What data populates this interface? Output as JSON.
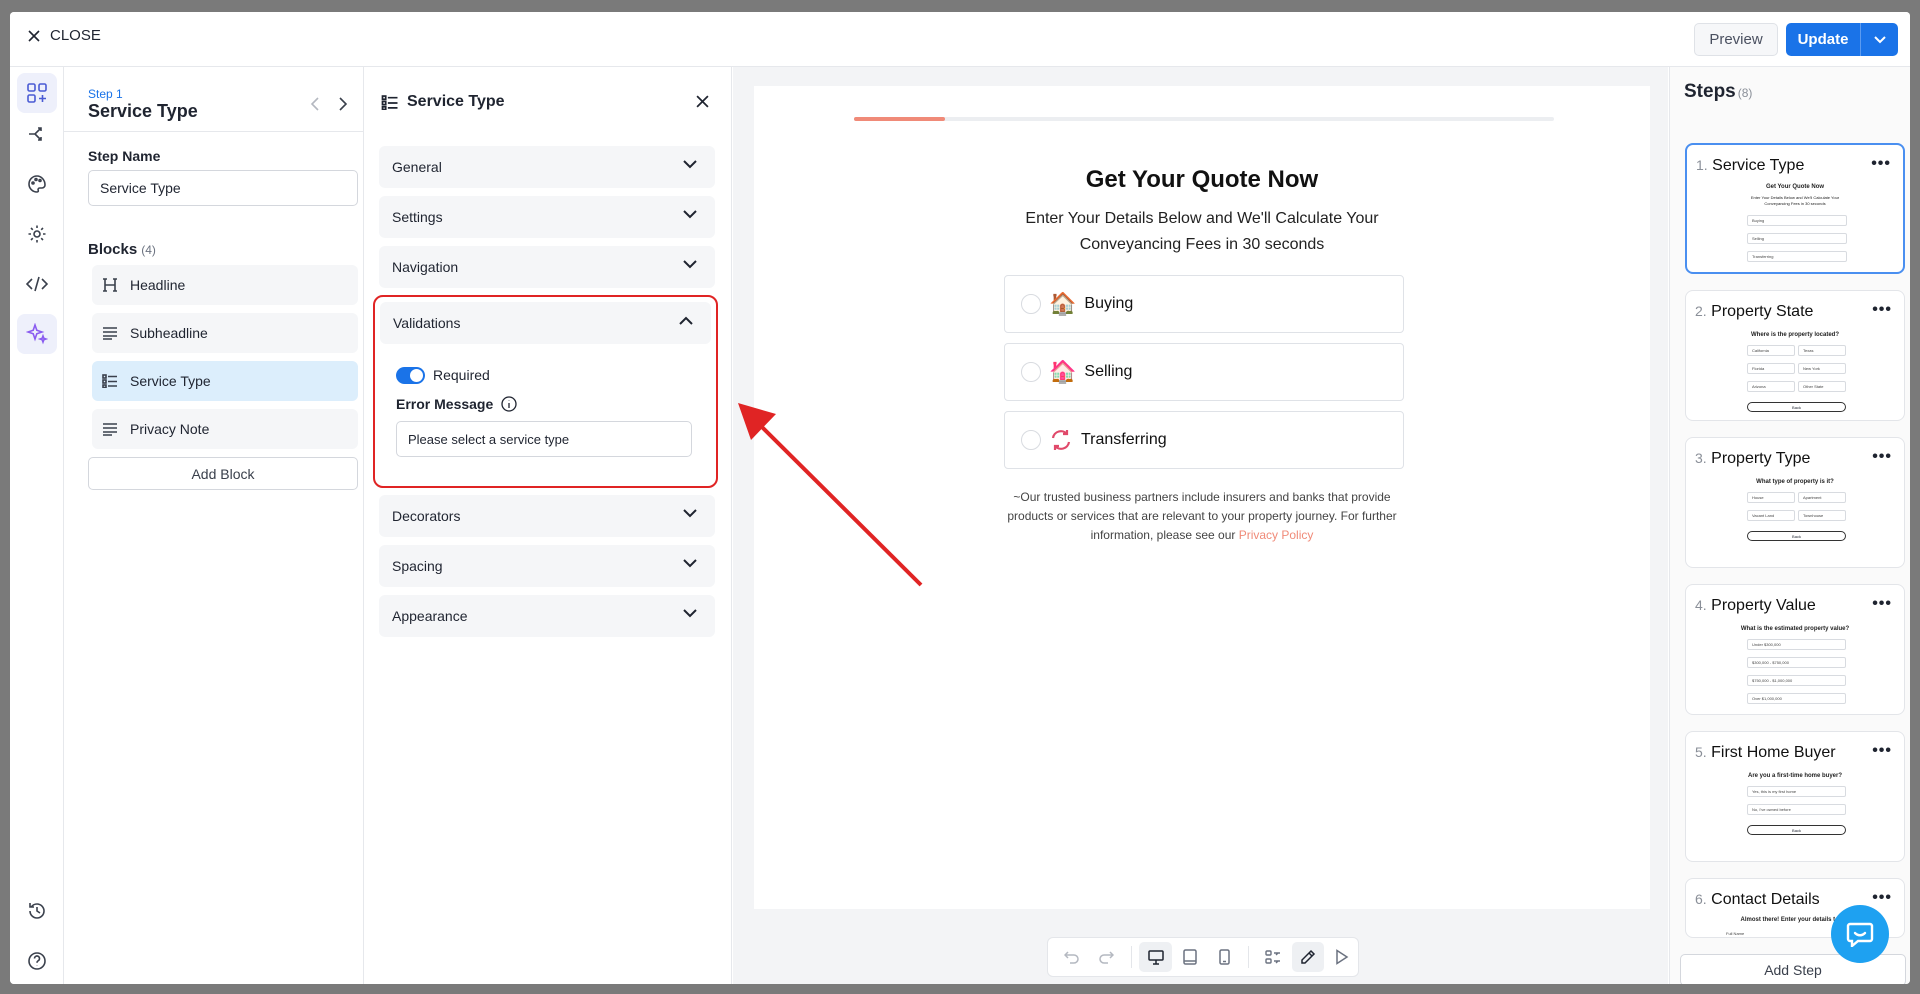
{
  "topbar": {
    "close_label": "CLOSE",
    "preview_label": "Preview",
    "update_label": "Update"
  },
  "step_panel": {
    "step_number": "Step 1",
    "step_title": "Service Type",
    "step_name_label": "Step Name",
    "step_name_value": "Service Type",
    "blocks_label": "Blocks",
    "blocks_count": "(4)",
    "blocks": [
      {
        "label": "Headline",
        "icon": "heading-icon"
      },
      {
        "label": "Subheadline",
        "icon": "text-lines-icon"
      },
      {
        "label": "Service Type",
        "icon": "list-icon"
      },
      {
        "label": "Privacy Note",
        "icon": "text-lines-icon"
      }
    ],
    "add_block_label": "Add Block"
  },
  "settings": {
    "title": "Service Type",
    "sections": [
      "General",
      "Settings",
      "Navigation",
      "Validations",
      "Decorators",
      "Spacing",
      "Appearance"
    ],
    "validations": {
      "required_label": "Required",
      "required_on": true,
      "error_message_label": "Error Message",
      "error_message_value": "Please select a service type"
    }
  },
  "form": {
    "progress": 0.13,
    "title": "Get Your Quote Now",
    "subtitle": "Enter Your Details Below and We'll Calculate Your Conveyancing Fees in 30 seconds",
    "options": [
      {
        "label": "Buying",
        "emoji": "🏠"
      },
      {
        "label": "Selling",
        "emoji": "🏠"
      },
      {
        "label": "Transferring",
        "emoji": "🔄"
      }
    ],
    "privacy_text": "~Our trusted business partners include insurers and banks that provide products or services that are relevant to your property journey. For further information, please see our",
    "privacy_link": "Privacy Policy"
  },
  "steps": {
    "title": "Steps",
    "count": "(8)",
    "items": [
      {
        "num": "1.",
        "title": "Service Type",
        "question": "Get Your Quote Now",
        "selected": true
      },
      {
        "num": "2.",
        "title": "Property State",
        "question": "Where is the property located?"
      },
      {
        "num": "3.",
        "title": "Property Type",
        "question": "What type of property is it?"
      },
      {
        "num": "4.",
        "title": "Property Value",
        "question": "What is the estimated property value?"
      },
      {
        "num": "5.",
        "title": "First Home Buyer",
        "question": "Are you a first-time home buyer?"
      },
      {
        "num": "6.",
        "title": "Contact Details",
        "question": "Almost there! Enter your details to get"
      }
    ],
    "add_step_label": "Add Step",
    "mini": {
      "s1": {
        "sub1": "Enter Your Details Below and We'll Calculate Your",
        "sub2": "Conveyancing Fees in 30 seconds",
        "opts": [
          "Buying",
          "Selling",
          "Transferring"
        ]
      },
      "s2": {
        "opts": [
          "California",
          "Texas",
          "Florida",
          "New York",
          "Arizona",
          "Other State"
        ],
        "back": "Back"
      },
      "s3": {
        "opts": [
          "House",
          "Apartment",
          "Vacant Land",
          "Townhouse"
        ],
        "back": "Back"
      },
      "s4": {
        "opts": [
          "Under $300,000",
          "$300,000 - $750,000",
          "$750,000 - $1,000,000",
          "Over $1,000,000"
        ]
      },
      "s5": {
        "opts": [
          "Yes, this is my first home",
          "No, I've owned before"
        ],
        "back": "Back"
      },
      "s6": {
        "field": "Full Name"
      }
    }
  }
}
